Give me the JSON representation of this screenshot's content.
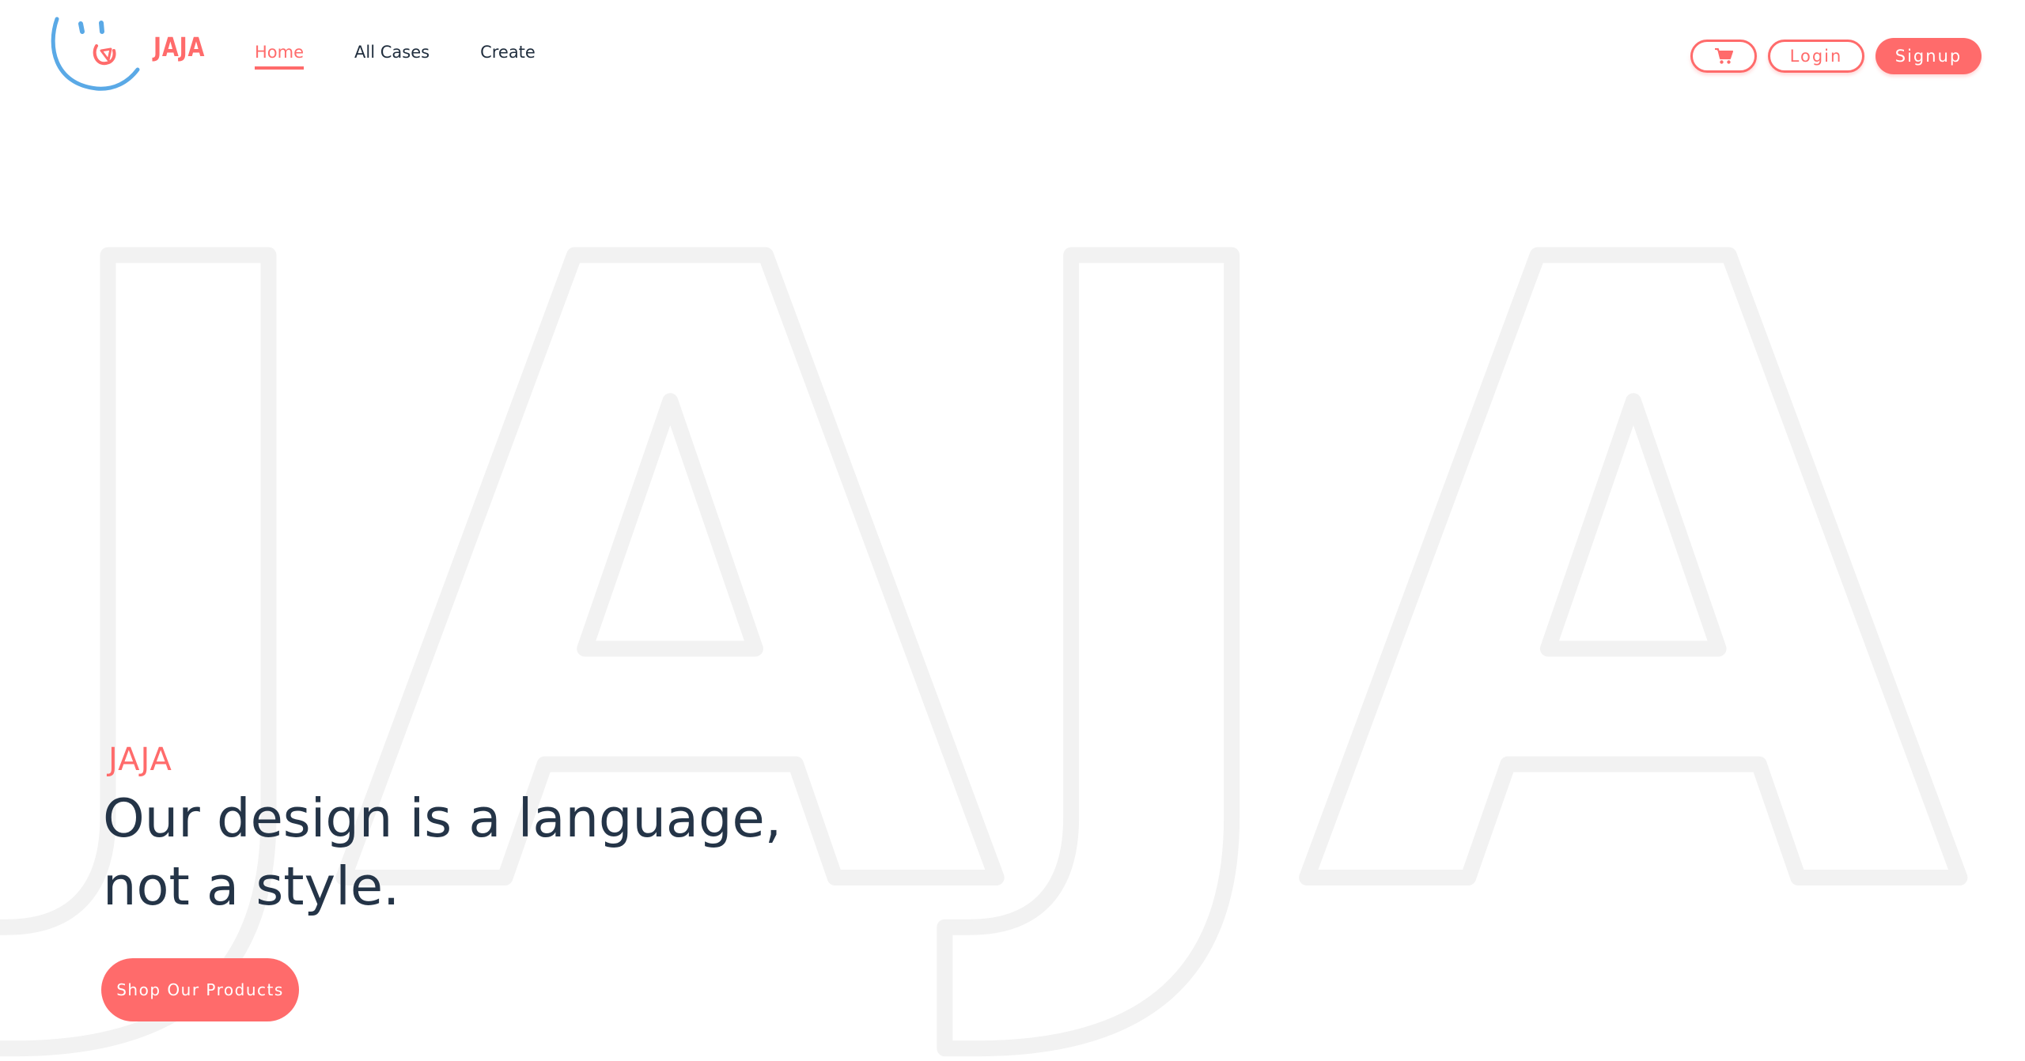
{
  "brand": {
    "logo_text": "JAJA"
  },
  "nav": {
    "items": [
      {
        "label": "Home",
        "active": true
      },
      {
        "label": "All Cases",
        "active": false
      },
      {
        "label": "Create",
        "active": false
      }
    ]
  },
  "actions": {
    "cart_icon": "shopping-cart-icon",
    "login_label": "Login",
    "signup_label": "Signup"
  },
  "hero": {
    "watermark_text": "JAJA",
    "brand_label": "JAJA",
    "heading_line1": "Our design is a language,",
    "heading_line2": "not a style.",
    "cta_label": "Shop Our Products"
  },
  "colors": {
    "accent": "#ff6b6b",
    "heading": "#243447",
    "logo_blue": "#5aa9e6",
    "watermark_stroke": "#f2f2f2"
  }
}
